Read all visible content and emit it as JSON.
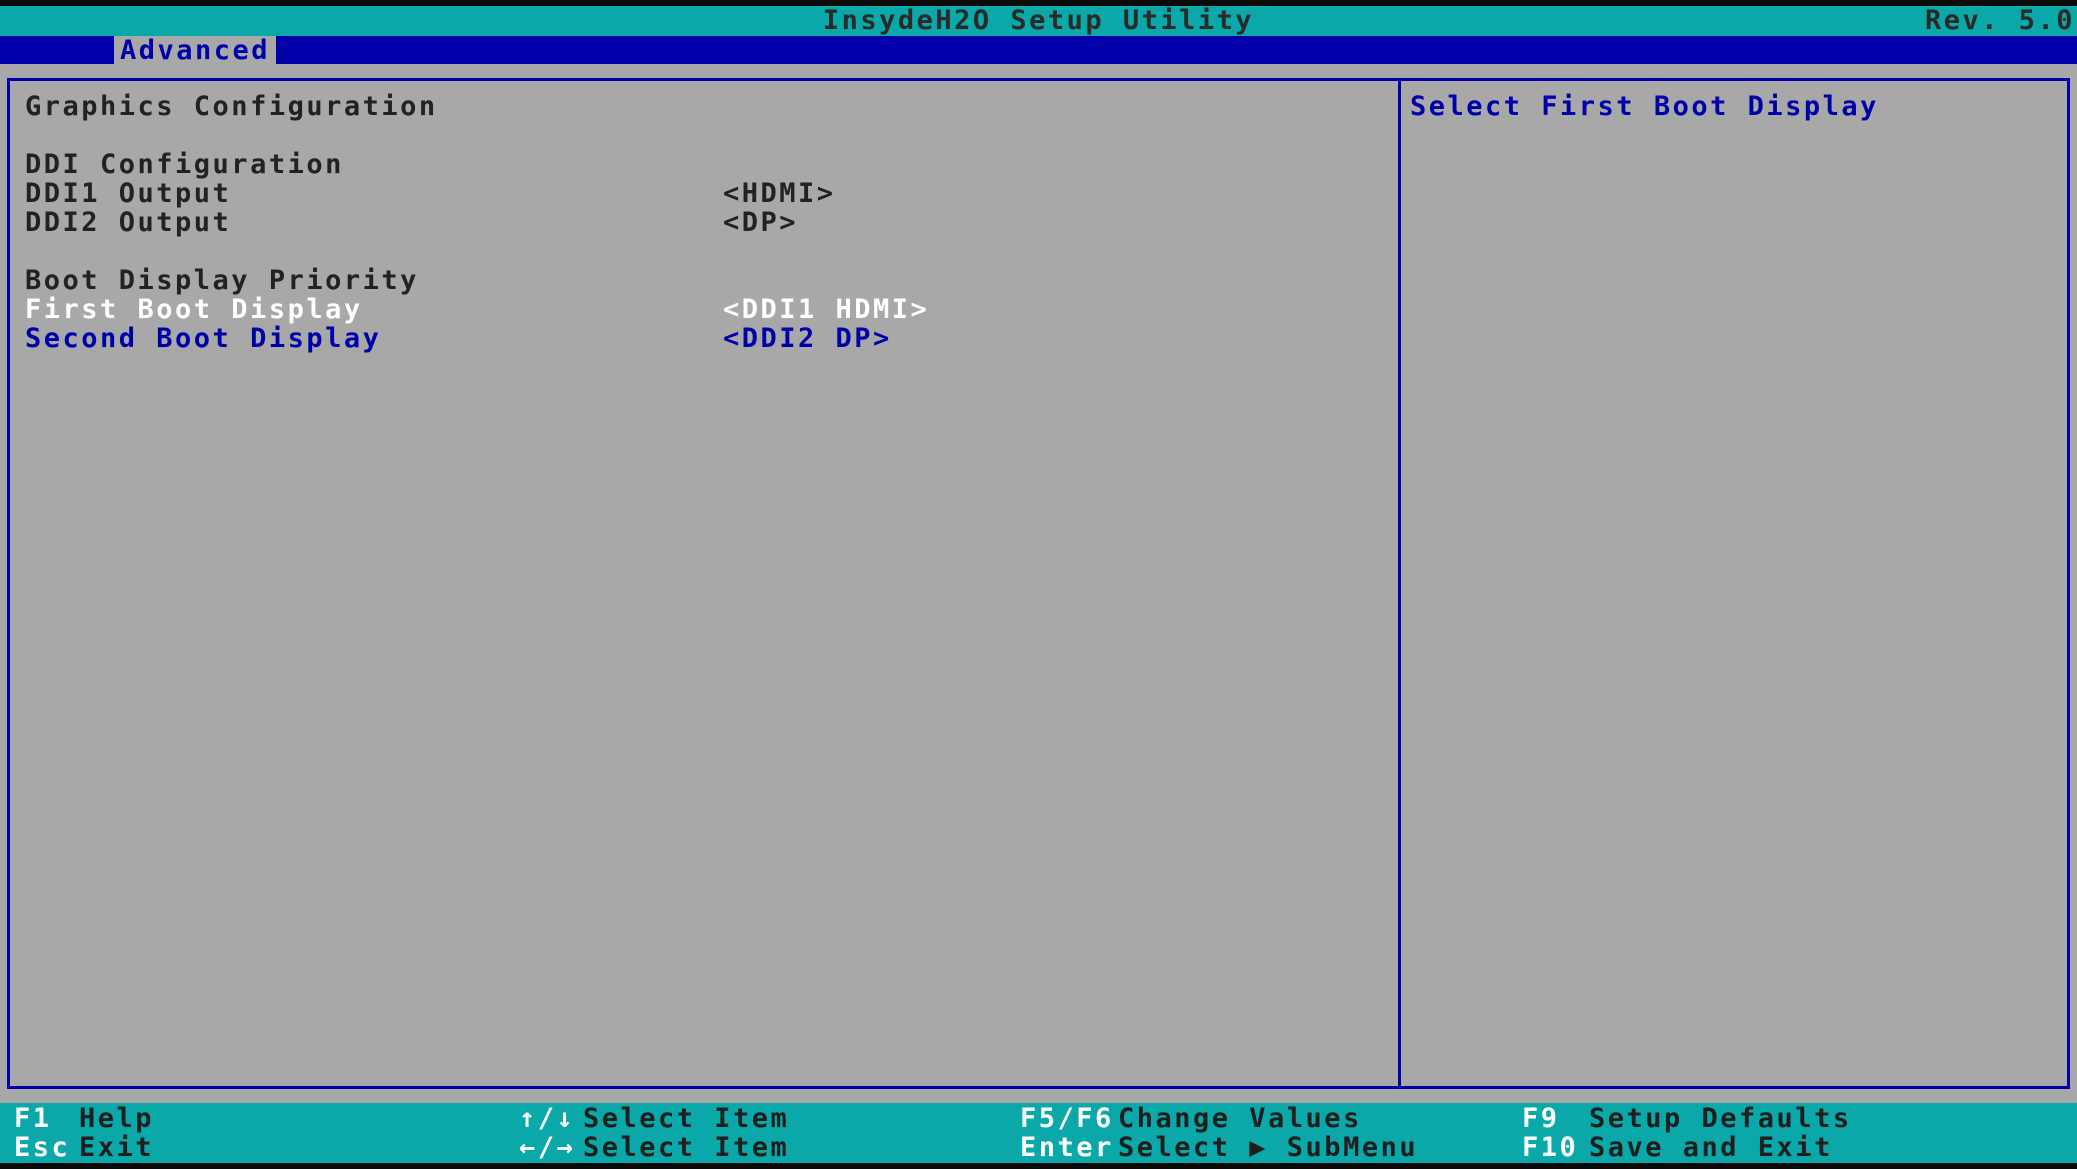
{
  "title_bar": {
    "title": "InsydeH2O Setup Utility",
    "revision": "Rev. 5.0"
  },
  "menu": {
    "tabs": [
      {
        "label": "Advanced",
        "selected": true
      }
    ]
  },
  "main": {
    "section_title": "Graphics Configuration",
    "ddi_header": "DDI Configuration",
    "ddi_settings": [
      {
        "label": "DDI1 Output",
        "value": "<HDMI>"
      },
      {
        "label": "DDI2 Output",
        "value": "<DP>"
      }
    ],
    "boot_header": "Boot Display Priority",
    "boot_settings": [
      {
        "label": "First Boot Display",
        "value": "<DDI1 HDMI>",
        "selected": true
      },
      {
        "label": "Second Boot Display",
        "value": "<DDI2 DP>",
        "selected": false
      }
    ]
  },
  "help_panel": {
    "text": "Select First Boot Display"
  },
  "help_bar": {
    "items": [
      {
        "key": "F1",
        "desc": "Help"
      },
      {
        "key": "Esc",
        "desc": "Exit"
      },
      {
        "key": "↑/↓",
        "desc": "Select Item"
      },
      {
        "key": "←/→",
        "desc": "Select Item"
      },
      {
        "key": "F5/F6",
        "desc": "Change Values"
      },
      {
        "key": "Enter",
        "desc": "Select ▶ SubMenu"
      },
      {
        "key": "F9",
        "desc": "Setup Defaults"
      },
      {
        "key": "F10",
        "desc": "Save and Exit"
      }
    ]
  },
  "colors": {
    "title_bar_bg": "#0aa8a8",
    "menu_bar_bg": "#0000aa",
    "panel_bg": "#a8a8a8",
    "highlight_text": "#ffffff",
    "link_text": "#0000aa"
  }
}
